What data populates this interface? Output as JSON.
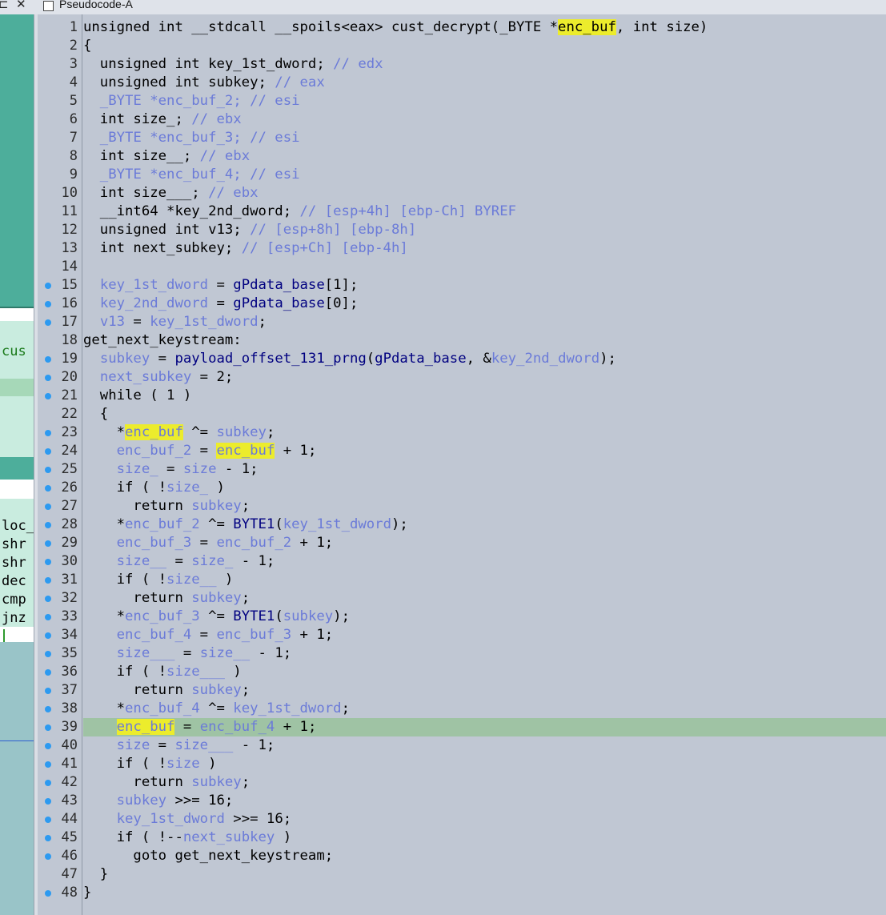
{
  "window": {
    "tab_title": "Pseudocode-A",
    "controls": [
      "⊏",
      "✕"
    ]
  },
  "left_panel": {
    "fragments": [
      "cus",
      "loc_",
      "shr",
      "shr",
      "dec",
      "cmp",
      "jnz"
    ]
  },
  "colors": {
    "code_background": "#c0c7d3",
    "highlight": "#ecec2c",
    "current_line": "#9fc3a4",
    "variable": "#6b7bd8",
    "global": "#000080",
    "breakpoint_dot": "#2d9af0"
  },
  "dot_lines": [
    15,
    16,
    17,
    19,
    20,
    21,
    23,
    24,
    25,
    26,
    27,
    28,
    29,
    30,
    31,
    32,
    33,
    34,
    35,
    36,
    37,
    38,
    39,
    40,
    41,
    42,
    43,
    44,
    45,
    46,
    48
  ],
  "current_line": 39,
  "lines": [
    [
      {
        "t": "unsigned int __stdcall __spoils<eax> cust_decrypt(_BYTE *"
      },
      {
        "t": "enc_buf",
        "c": "hl"
      },
      {
        "t": ", int size)"
      }
    ],
    [
      {
        "t": "{"
      }
    ],
    [
      {
        "t": "  unsigned int key_1st_dword; "
      },
      {
        "t": "// edx",
        "c": "c"
      }
    ],
    [
      {
        "t": "  unsigned int subkey; "
      },
      {
        "t": "// eax",
        "c": "c"
      }
    ],
    [
      {
        "t": "  _BYTE *enc_buf_2; ",
        "c": "v"
      },
      {
        "t": "// esi",
        "c": "c"
      }
    ],
    [
      {
        "t": "  int size_; "
      },
      {
        "t": "// ebx",
        "c": "c"
      }
    ],
    [
      {
        "t": "  _BYTE *enc_buf_3; ",
        "c": "v"
      },
      {
        "t": "// esi",
        "c": "c"
      }
    ],
    [
      {
        "t": "  int size__; "
      },
      {
        "t": "// ebx",
        "c": "c"
      }
    ],
    [
      {
        "t": "  _BYTE *enc_buf_4; ",
        "c": "v"
      },
      {
        "t": "// esi",
        "c": "c"
      }
    ],
    [
      {
        "t": "  int size___; "
      },
      {
        "t": "// ebx",
        "c": "c"
      }
    ],
    [
      {
        "t": "  __int64 *key_2nd_dword; "
      },
      {
        "t": "// [esp+4h] [ebp-Ch] BYREF",
        "c": "c"
      }
    ],
    [
      {
        "t": "  unsigned int v13; "
      },
      {
        "t": "// [esp+8h] [ebp-8h]",
        "c": "c"
      }
    ],
    [
      {
        "t": "  int next_subkey; "
      },
      {
        "t": "// [esp+Ch] [ebp-4h]",
        "c": "c"
      }
    ],
    [
      {
        "t": ""
      }
    ],
    [
      {
        "t": "  "
      },
      {
        "t": "key_1st_dword",
        "c": "v"
      },
      {
        "t": " = "
      },
      {
        "t": "gPdata_base",
        "c": "g"
      },
      {
        "t": "[1];"
      }
    ],
    [
      {
        "t": "  "
      },
      {
        "t": "key_2nd_dword",
        "c": "v"
      },
      {
        "t": " = "
      },
      {
        "t": "gPdata_base",
        "c": "g"
      },
      {
        "t": "[0];"
      }
    ],
    [
      {
        "t": "  "
      },
      {
        "t": "v13",
        "c": "v"
      },
      {
        "t": " = "
      },
      {
        "t": "key_1st_dword",
        "c": "v"
      },
      {
        "t": ";"
      }
    ],
    [
      {
        "t": "get_next_keystream:"
      }
    ],
    [
      {
        "t": "  "
      },
      {
        "t": "subkey",
        "c": "v"
      },
      {
        "t": " = "
      },
      {
        "t": "payload_offset_131_prng",
        "c": "g"
      },
      {
        "t": "("
      },
      {
        "t": "gPdata_base",
        "c": "g"
      },
      {
        "t": ", &"
      },
      {
        "t": "key_2nd_dword",
        "c": "v"
      },
      {
        "t": ");"
      }
    ],
    [
      {
        "t": "  "
      },
      {
        "t": "next_subkey",
        "c": "v"
      },
      {
        "t": " = 2;"
      }
    ],
    [
      {
        "t": "  while ( 1 )"
      }
    ],
    [
      {
        "t": "  {"
      }
    ],
    [
      {
        "t": "    *"
      },
      {
        "t": "enc_buf",
        "c": "hl v"
      },
      {
        "t": " ^= "
      },
      {
        "t": "subkey",
        "c": "v"
      },
      {
        "t": ";"
      }
    ],
    [
      {
        "t": "    "
      },
      {
        "t": "enc_buf_2",
        "c": "v"
      },
      {
        "t": " = "
      },
      {
        "t": "enc_buf",
        "c": "hl v"
      },
      {
        "t": " + 1;"
      }
    ],
    [
      {
        "t": "    "
      },
      {
        "t": "size_",
        "c": "v"
      },
      {
        "t": " = "
      },
      {
        "t": "size",
        "c": "v"
      },
      {
        "t": " - 1;"
      }
    ],
    [
      {
        "t": "    if ( !"
      },
      {
        "t": "size_",
        "c": "v"
      },
      {
        "t": " )"
      }
    ],
    [
      {
        "t": "      return "
      },
      {
        "t": "subkey",
        "c": "v"
      },
      {
        "t": ";"
      }
    ],
    [
      {
        "t": "    *"
      },
      {
        "t": "enc_buf_2",
        "c": "v"
      },
      {
        "t": " ^= "
      },
      {
        "t": "BYTE1",
        "c": "g"
      },
      {
        "t": "("
      },
      {
        "t": "key_1st_dword",
        "c": "v"
      },
      {
        "t": ");"
      }
    ],
    [
      {
        "t": "    "
      },
      {
        "t": "enc_buf_3",
        "c": "v"
      },
      {
        "t": " = "
      },
      {
        "t": "enc_buf_2",
        "c": "v"
      },
      {
        "t": " + 1;"
      }
    ],
    [
      {
        "t": "    "
      },
      {
        "t": "size__",
        "c": "v"
      },
      {
        "t": " = "
      },
      {
        "t": "size_",
        "c": "v"
      },
      {
        "t": " - 1;"
      }
    ],
    [
      {
        "t": "    if ( !"
      },
      {
        "t": "size__",
        "c": "v"
      },
      {
        "t": " )"
      }
    ],
    [
      {
        "t": "      return "
      },
      {
        "t": "subkey",
        "c": "v"
      },
      {
        "t": ";"
      }
    ],
    [
      {
        "t": "    *"
      },
      {
        "t": "enc_buf_3",
        "c": "v"
      },
      {
        "t": " ^= "
      },
      {
        "t": "BYTE1",
        "c": "g"
      },
      {
        "t": "("
      },
      {
        "t": "subkey",
        "c": "v"
      },
      {
        "t": ");"
      }
    ],
    [
      {
        "t": "    "
      },
      {
        "t": "enc_buf_4",
        "c": "v"
      },
      {
        "t": " = "
      },
      {
        "t": "enc_buf_3",
        "c": "v"
      },
      {
        "t": " + 1;"
      }
    ],
    [
      {
        "t": "    "
      },
      {
        "t": "size___",
        "c": "v"
      },
      {
        "t": " = "
      },
      {
        "t": "size__",
        "c": "v"
      },
      {
        "t": " - 1;"
      }
    ],
    [
      {
        "t": "    if ( !"
      },
      {
        "t": "size___",
        "c": "v"
      },
      {
        "t": " )"
      }
    ],
    [
      {
        "t": "      return "
      },
      {
        "t": "subkey",
        "c": "v"
      },
      {
        "t": ";"
      }
    ],
    [
      {
        "t": "    *"
      },
      {
        "t": "enc_buf_4",
        "c": "v"
      },
      {
        "t": " ^= "
      },
      {
        "t": "key_1st_dword",
        "c": "v"
      },
      {
        "t": ";"
      }
    ],
    [
      {
        "t": "    "
      },
      {
        "t": "enc_buf",
        "c": "hl v"
      },
      {
        "t": " = "
      },
      {
        "t": "enc_buf_4",
        "c": "v"
      },
      {
        "t": " + 1;"
      }
    ],
    [
      {
        "t": "    "
      },
      {
        "t": "size",
        "c": "v"
      },
      {
        "t": " = "
      },
      {
        "t": "size___",
        "c": "v"
      },
      {
        "t": " - 1;"
      }
    ],
    [
      {
        "t": "    if ( !"
      },
      {
        "t": "size",
        "c": "v"
      },
      {
        "t": " )"
      }
    ],
    [
      {
        "t": "      return "
      },
      {
        "t": "subkey",
        "c": "v"
      },
      {
        "t": ";"
      }
    ],
    [
      {
        "t": "    "
      },
      {
        "t": "subkey",
        "c": "v"
      },
      {
        "t": " >>= 16;"
      }
    ],
    [
      {
        "t": "    "
      },
      {
        "t": "key_1st_dword",
        "c": "v"
      },
      {
        "t": " >>= 16;"
      }
    ],
    [
      {
        "t": "    if ( !--"
      },
      {
        "t": "next_subkey",
        "c": "v"
      },
      {
        "t": " )"
      }
    ],
    [
      {
        "t": "      goto get_next_keystream;"
      }
    ],
    [
      {
        "t": "  }"
      }
    ],
    [
      {
        "t": "}"
      }
    ]
  ]
}
